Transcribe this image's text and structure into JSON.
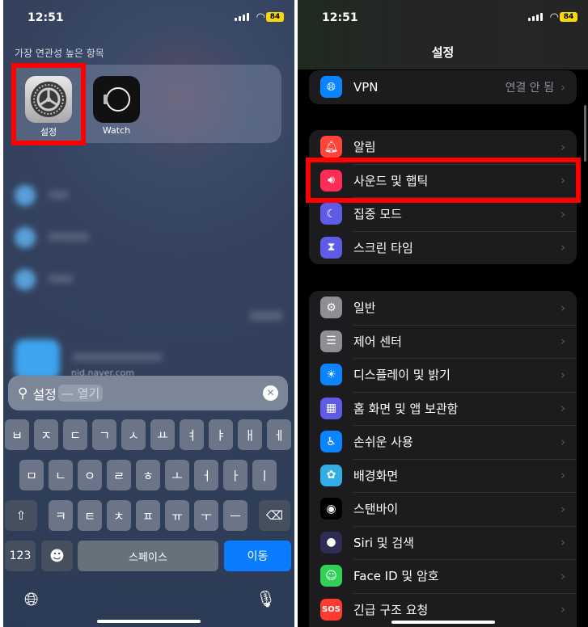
{
  "left": {
    "status": {
      "time": "12:51",
      "battery": "84"
    },
    "section_title": "가장 연관성 높은 항목",
    "apps": [
      {
        "label": "설정",
        "icon": "gear-icon"
      },
      {
        "label": "Watch",
        "icon": "watch-icon"
      }
    ],
    "blurred_url": "nid.naver.com",
    "search": {
      "value": "설정",
      "suggestion": "— 열기"
    },
    "keyboard": {
      "row1": [
        "ㅂ",
        "ㅈ",
        "ㄷ",
        "ㄱ",
        "ㅅ",
        "ㅛ",
        "ㅕ",
        "ㅑ",
        "ㅐ",
        "ㅔ"
      ],
      "row2": [
        "ㅁ",
        "ㄴ",
        "ㅇ",
        "ㄹ",
        "ㅎ",
        "ㅗ",
        "ㅓ",
        "ㅏ",
        "ㅣ"
      ],
      "row3": [
        "ㅋ",
        "ㅌ",
        "ㅊ",
        "ㅍ",
        "ㅠ",
        "ㅜ",
        "ㅡ"
      ],
      "numbers": "123",
      "space": "스페이스",
      "go": "이동"
    }
  },
  "right": {
    "status": {
      "time": "12:51",
      "battery": "84"
    },
    "title": "설정",
    "groups": [
      [
        {
          "label": "VPN",
          "value": "연결 안 됨",
          "icon": "vpn-icon",
          "color": "#0a84ff"
        }
      ],
      [
        {
          "label": "알림",
          "icon": "bell-icon",
          "color": "#ff453a"
        },
        {
          "label": "사운드 및 햅틱",
          "icon": "speaker-icon",
          "color": "#ff2d55"
        },
        {
          "label": "집중 모드",
          "icon": "moon-icon",
          "color": "#5e5ce6"
        },
        {
          "label": "스크린 타임",
          "icon": "hourglass-icon",
          "color": "#5e5ce6"
        }
      ],
      [
        {
          "label": "일반",
          "icon": "gear-icon",
          "color": "#8e8e93"
        },
        {
          "label": "제어 센터",
          "icon": "toggles-icon",
          "color": "#8e8e93"
        },
        {
          "label": "디스플레이 및 밝기",
          "icon": "sun-icon",
          "color": "#0a84ff"
        },
        {
          "label": "홈 화면 및 앱 보관함",
          "icon": "grid-icon",
          "color": "#5e5ce6"
        },
        {
          "label": "손쉬운 사용",
          "icon": "accessibility-icon",
          "color": "#0a84ff"
        },
        {
          "label": "배경화면",
          "icon": "flower-icon",
          "color": "#32ade6"
        },
        {
          "label": "스탠바이",
          "icon": "standby-icon",
          "color": "#000000"
        },
        {
          "label": "Siri 및 검색",
          "icon": "siri-icon",
          "color": "#2c2c54"
        },
        {
          "label": "Face ID 및 암호",
          "icon": "faceid-icon",
          "color": "#30d158"
        },
        {
          "label": "긴급 구조 요청",
          "icon": "sos-icon",
          "color": "#ff3b30"
        }
      ]
    ]
  },
  "highlight_color": "#ff0000"
}
